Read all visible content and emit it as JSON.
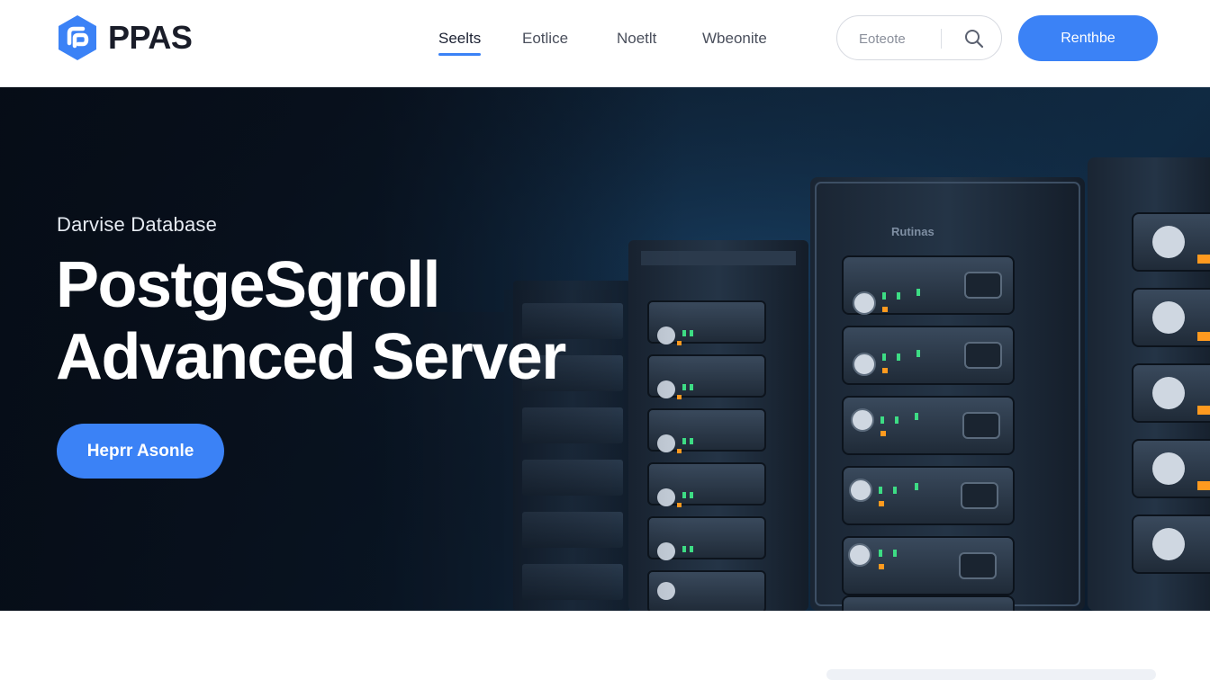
{
  "brand": {
    "name": "PPAS",
    "accent": "#3b82f6",
    "logo_color": "#3b82f6"
  },
  "nav": {
    "items": [
      {
        "label": "Seelts",
        "active": true
      },
      {
        "label": "Eotlice",
        "active": false
      },
      {
        "label": "Noetlt",
        "active": false
      },
      {
        "label": "Wbeonite",
        "active": false
      }
    ]
  },
  "search": {
    "placeholder": "Eoteote",
    "icon": "search-icon"
  },
  "header_cta": {
    "label": "Renthbe"
  },
  "hero": {
    "eyebrow": "Darvise Database",
    "title_line1": "PostgeSgroll",
    "title_line2": "Advanced Server",
    "button_label": "Heprr Asonle",
    "rack_label": "Rutinas",
    "colors": {
      "background": "#0e2236",
      "led_green": "#3ddc84",
      "led_orange": "#ff9a1f"
    }
  }
}
